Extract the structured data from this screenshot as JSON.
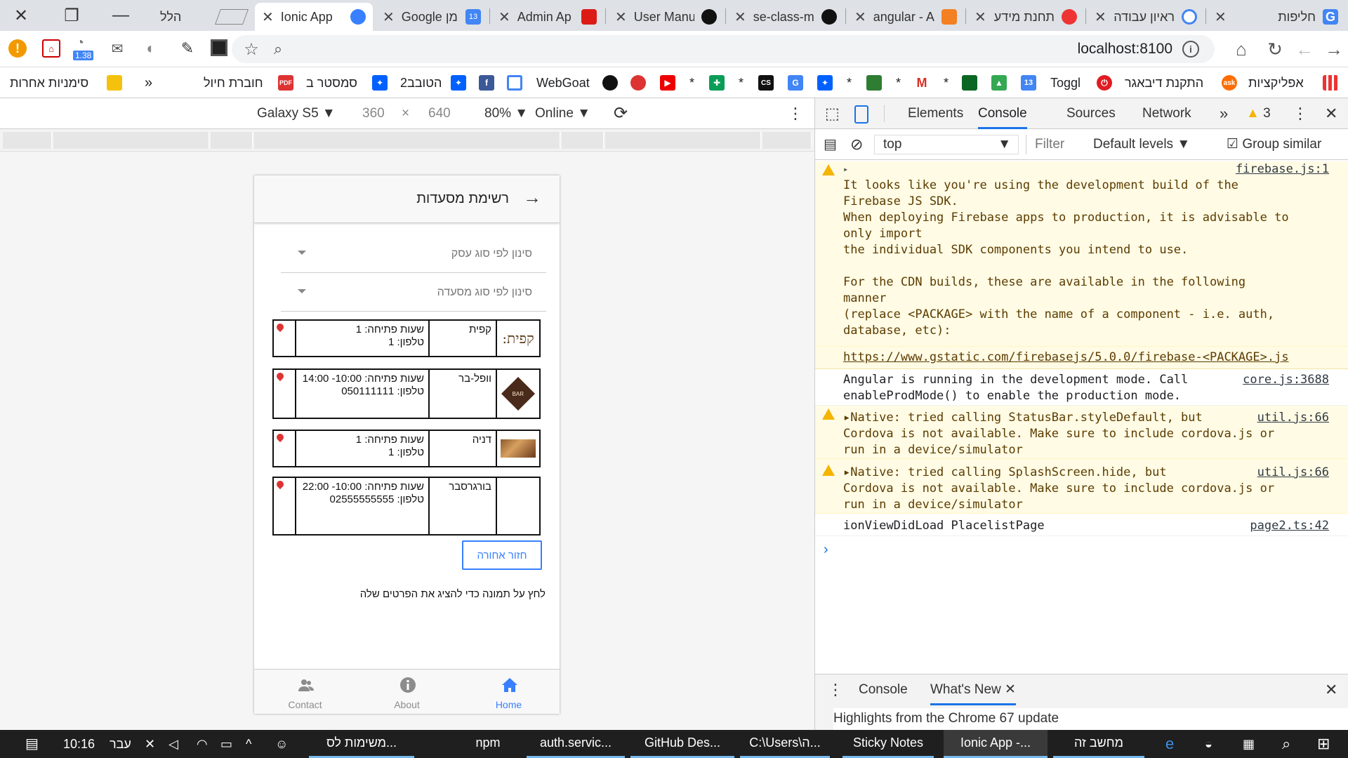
{
  "tabs": [
    {
      "title": "חליפות",
      "fav": "G",
      "color": "#4285f4"
    },
    {
      "title": "ראיון עבודה",
      "fav": "G",
      "color": "#4285f4"
    },
    {
      "title": "תחנת מידע",
      "fav": "♡",
      "color": "#e33"
    },
    {
      "title": "angular - A",
      "fav": "S",
      "color": "#f48024"
    },
    {
      "title": "se-class-m",
      "fav": "gh",
      "color": "#111"
    },
    {
      "title": "User Manu",
      "fav": "gh",
      "color": "#111"
    },
    {
      "title": "Admin Ap",
      "fav": "A",
      "color": "#dd1b16"
    },
    {
      "title": "Google יומן",
      "fav": "13",
      "color": "#4285f4"
    },
    {
      "title": "Ionic App",
      "fav": "◉",
      "color": "#3880ff"
    },
    {
      "title": "",
      "fav": "",
      "color": ""
    },
    {
      "title": "הלל",
      "fav": "",
      "color": ""
    }
  ],
  "address": {
    "url": "localhost:8100"
  },
  "extensions": {
    "badge": "1.38"
  },
  "bookmarks": [
    {
      "label": "אפליקציות",
      "color": "#e33"
    },
    {
      "label": "",
      "color": "#ff6d00"
    },
    {
      "label": "התקנת דיבאגר",
      "color": "#e33"
    },
    {
      "label": "",
      "color": "#e33"
    },
    {
      "label": "Toggl",
      "color": "#e01b22"
    },
    {
      "label": "",
      "color": "#4285f4"
    },
    {
      "label": "",
      "color": "#34a853"
    },
    {
      "label": "*",
      "color": "#0b6623"
    },
    {
      "label": "*",
      "color": "#d93025"
    },
    {
      "label": "*",
      "color": "#2e7d32"
    },
    {
      "label": "*",
      "color": "#0061fe"
    },
    {
      "label": "",
      "color": "#4285f4"
    },
    {
      "label": "",
      "color": "#111"
    },
    {
      "label": "*",
      "color": "#0a9d58"
    },
    {
      "label": "*",
      "color": "#e00"
    },
    {
      "label": "",
      "color": "#d33"
    },
    {
      "label": "",
      "color": "#111"
    },
    {
      "label": "WebGoat",
      "color": "#4285f4"
    },
    {
      "label": "",
      "color": "#3b5998"
    },
    {
      "label": "הטובב2",
      "color": "#0061fe"
    },
    {
      "label": "סמסטר ב",
      "color": "#0061fe"
    },
    {
      "label": "חוברת חיול",
      "color": "#d33"
    },
    {
      "label": "»",
      "color": ""
    },
    {
      "label": "סימניות אחרות",
      "color": "#f4c20d"
    }
  ],
  "device": {
    "name": "Galaxy S5",
    "width": "360",
    "height": "640",
    "zoom": "80%",
    "network": "Online"
  },
  "app": {
    "title": "רשימת מסעדות",
    "filter_business": "סינון לפי סוג עסק",
    "filter_restaurant": "סינון לפי סוג מסעדה",
    "rows": [
      {
        "name": "קפית",
        "hours": "שעות פתיחה: 1",
        "phone": "טלפון: 1",
        "logo": "קפית:"
      },
      {
        "name": "וופל-בר",
        "hours": "שעות פתיחה: 10:00- 14:00",
        "phone": "טלפון: 050111111",
        "logo": "BAR"
      },
      {
        "name": "דניה",
        "hours": "שעות פתיחה: 1",
        "phone": "טלפון: 1",
        "logo": ""
      },
      {
        "name": "בורגרסבר",
        "hours": "שעות פתיחה: 10:00- 22:00",
        "phone": "טלפון: 02555555555",
        "logo": ""
      }
    ],
    "back_button": "חזור אחורה",
    "hint": "לחץ על תמונה כדי להציג את הפרטים שלה",
    "tabbar": [
      {
        "label": "Contact"
      },
      {
        "label": "About"
      },
      {
        "label": "Home"
      }
    ]
  },
  "devtools": {
    "tabs": [
      "Elements",
      "Console",
      "Sources",
      "Network"
    ],
    "warn_count": "3",
    "context": "top",
    "filter_placeholder": "Filter",
    "levels": "Default levels",
    "group_similar": "Group similar",
    "messages": [
      {
        "type": "warn",
        "source": "firebase.js:1",
        "lines": [
          "It looks like you're using the development build of the",
          "Firebase JS SDK.",
          "When deploying Firebase apps to production, it is advisable to",
          "only import",
          "the individual SDK components you intend to use.",
          "",
          "For the CDN builds, these are available in the following",
          "manner",
          "(replace <PACKAGE> with the name of a component - i.e. auth,",
          "database, etc):",
          "",
          "https://www.gstatic.com/firebasejs/5.0.0/firebase-<PACKAGE>.js"
        ]
      },
      {
        "type": "info",
        "source": "core.js:3688",
        "lines": [
          "Angular is running in the development mode. Call",
          "enableProdMode() to enable the production mode."
        ]
      },
      {
        "type": "warn",
        "source": "util.js:66",
        "lines": [
          "▸Native: tried calling StatusBar.styleDefault, but",
          "Cordova is not available. Make sure to include cordova.js or",
          "run in a device/simulator"
        ]
      },
      {
        "type": "warn",
        "source": "util.js:66",
        "lines": [
          "▸Native: tried calling SplashScreen.hide, but",
          "Cordova is not available. Make sure to include cordova.js or",
          "run in a device/simulator"
        ]
      },
      {
        "type": "info",
        "source": "page2.ts:42",
        "lines": [
          "ionViewDidLoad PlacelistPage"
        ]
      }
    ],
    "drawer_tabs": [
      "Console",
      "What's New"
    ],
    "drawer_text": "Highlights from the Chrome 67 update"
  },
  "taskbar": {
    "time": "10:16",
    "lang": "עבר",
    "apps": [
      "מחשב זה",
      "Ionic App -...",
      "Sticky Notes",
      "C:\\Users\\ה...",
      "GitHub Des...",
      "auth.servic...",
      "npm",
      "משימות לס..."
    ]
  }
}
